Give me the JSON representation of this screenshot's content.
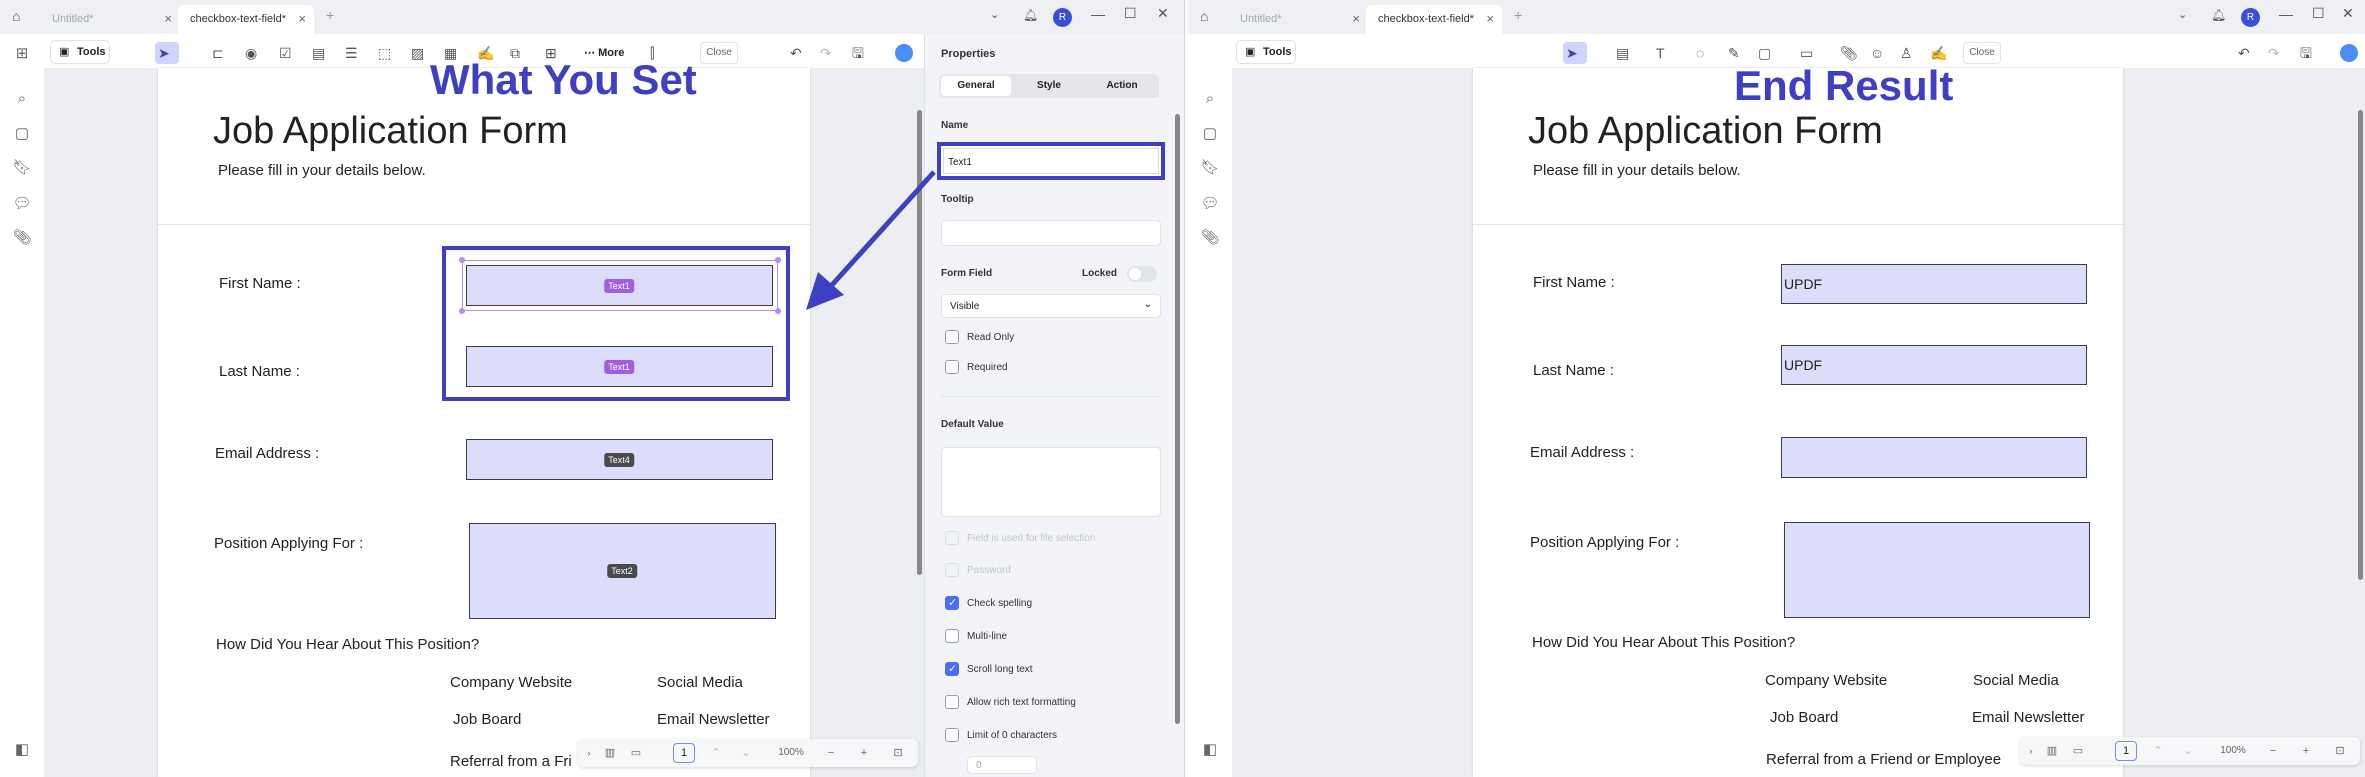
{
  "left": {
    "tabs": [
      {
        "label": "Untitled*"
      },
      {
        "label": "checkbox-text-field*"
      }
    ],
    "avatar": "R",
    "tools_label": "Tools",
    "more_label": "More",
    "close_label": "Close",
    "heading": "What You Set",
    "doc": {
      "title": "Job Application Form",
      "subtitle": "Please fill in your details below.",
      "first_name": "First Name :",
      "last_name": "Last Name :",
      "email": "Email Address :",
      "position": "Position Applying For :",
      "hear": "How Did You Hear About This Position?",
      "options": [
        "Company Website",
        "Social Media",
        "Job Board",
        "Email Newsletter",
        "Referral from a Fri"
      ]
    },
    "field_tags": {
      "first": "Text1",
      "last": "Text1",
      "email": "Text4",
      "position": "Text2"
    },
    "zoom": {
      "page": "1",
      "percent": "100%"
    },
    "props": {
      "title": "Properties",
      "tabs": [
        "General",
        "Style",
        "Action"
      ],
      "name_label": "Name",
      "name_value": "Text1",
      "tooltip_label": "Tooltip",
      "form_field_label": "Form Field",
      "locked_label": "Locked",
      "visibility": "Visible",
      "read_only": "Read Only",
      "required": "Required",
      "default_value_label": "Default Value",
      "file_selection": "Field is used for file selection",
      "password": "Password",
      "check_spelling": "Check spelling",
      "multi_line": "Multi-line",
      "scroll_long_text": "Scroll long text",
      "rich_text": "Allow rich text formatting",
      "limit": "Limit of 0 characters",
      "limit_value": "0"
    }
  },
  "right": {
    "tabs": [
      {
        "label": "Untitled*"
      },
      {
        "label": "checkbox-text-field*"
      }
    ],
    "avatar": "R",
    "tools_label": "Tools",
    "close_label": "Close",
    "heading": "End Result",
    "doc": {
      "title": "Job Application Form",
      "subtitle": "Please fill in your details below.",
      "first_name": "First Name :",
      "last_name": "Last Name :",
      "email": "Email Address :",
      "position": "Position Applying For :",
      "hear": "How Did You Hear About This Position?",
      "options": [
        "Company Website",
        "Social Media",
        "Job Board",
        "Email Newsletter",
        "Referral from a Friend or Employee"
      ]
    },
    "values": {
      "first": "UPDF",
      "last": "UPDF"
    },
    "zoom": {
      "page": "1",
      "percent": "100%"
    }
  },
  "colors": {
    "accent": "#3f3fc2",
    "field_fill": "#dcdcfb",
    "selection": "#b38cf5",
    "tag_purple": "#a25ee0",
    "tag_dark": "#4a4a4a"
  }
}
